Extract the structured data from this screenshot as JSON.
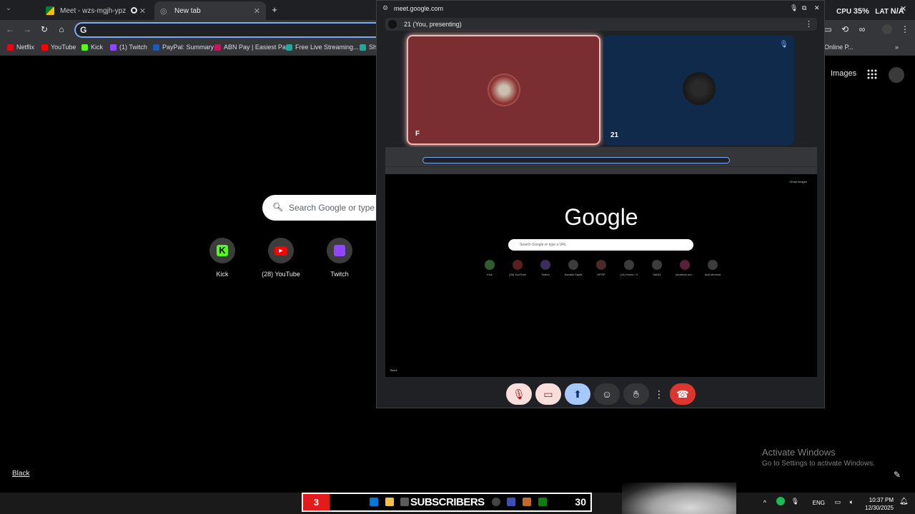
{
  "tabs": [
    {
      "label": "Meet - wzs-mgjh-ypz",
      "active": false
    },
    {
      "label": "New tab",
      "active": true
    }
  ],
  "toolbar": {
    "omnibox_value": "G"
  },
  "bookmarks": [
    "Netflix",
    "YouTube",
    "Kick",
    "(1) Twitch",
    "PayPal: Summary",
    "ABN Pay | Easiest Pa...",
    "Free Live Streaming...",
    "Sh",
    "Online P..."
  ],
  "ntp": {
    "search_placeholder": "Search Google or type a",
    "shortcuts": [
      "Kick",
      "(28) YouTube",
      "Twitch"
    ],
    "images_link": "Images",
    "black_link": "Black"
  },
  "perf": {
    "cpu_label": "CPU",
    "cpu_value": "35%",
    "lat_label": "LAT",
    "lat_value": "N/A"
  },
  "activate": {
    "title": "Activate Windows",
    "subtitle": "Go to Settings to activate Windows."
  },
  "pip": {
    "url": "meet.google.com",
    "presenter": "21 (You, presenting)",
    "tiles": [
      {
        "name": "F",
        "color": "#7a2e31"
      },
      {
        "name": "21",
        "color": "#0f2a4a"
      }
    ],
    "share": {
      "google_logo": "Google",
      "search_placeholder": "Search Google or type a URL",
      "shortcuts": [
        "Kick",
        "(28) YouTube",
        "Twitch",
        "Kanalin Sayfa",
        "MTRP",
        "(14) Home / X",
        "9A511",
        "showbox.mo...",
        "Add shortcut"
      ],
      "footer_left": "Black",
      "top_links": "Gmail  Images"
    }
  },
  "overlay": {
    "left_count": "3",
    "label": "SUBSCRIBERS",
    "right_count": "30"
  },
  "tray": {
    "lang": "ENG",
    "time": "10:37 PM",
    "date": "12/30/2025"
  }
}
